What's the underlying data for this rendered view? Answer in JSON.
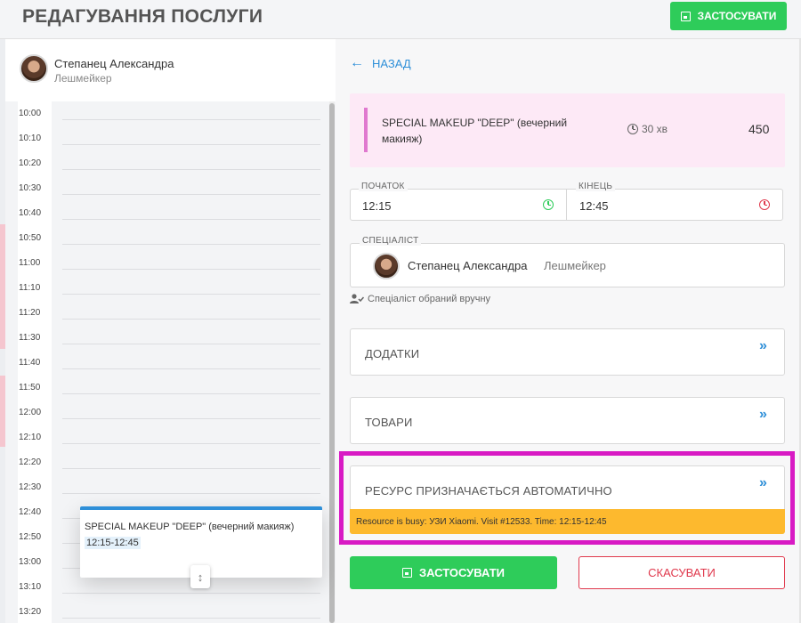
{
  "header": {
    "title": "РЕДАГУВАННЯ ПОСЛУГИ",
    "apply_label": "ЗАСТОСУВАТИ"
  },
  "specialist": {
    "name": "Степанец Александра",
    "role": "Лешмейкер"
  },
  "calendar": {
    "times": [
      "10:00",
      "10:10",
      "10:20",
      "10:30",
      "10:40",
      "10:50",
      "11:00",
      "11:10",
      "11:20",
      "11:30",
      "11:40",
      "11:50",
      "12:00",
      "12:10",
      "12:20",
      "12:30",
      "12:40",
      "12:50",
      "13:00",
      "13:10",
      "13:20"
    ],
    "event": {
      "title": "SPECIAL MAKEUP \"DEEP\" (вечерний макияж)",
      "time": "12:15-12:45",
      "color": "#2e8fd8"
    }
  },
  "form": {
    "back_label": "НАЗАД",
    "service": {
      "name": "SPECIAL MAKEUP \"DEEP\" (вечерний макияж)",
      "duration": "30 хв",
      "price": "450"
    },
    "start": {
      "label": "ПОЧАТОК",
      "value": "12:15"
    },
    "end": {
      "label": "КІНЕЦЬ",
      "value": "12:45"
    },
    "specialist": {
      "label": "СПЕЦІАЛІСТ",
      "name": "Степанец Александра",
      "role": "Лешмейкер",
      "note": "Спеціаліст обраний вручну"
    },
    "addons_label": "ДОДАТКИ",
    "goods_label": "ТОВАРИ",
    "resource_label": "РЕСУРС ПРИЗНАЧАЄТЬСЯ АВТОМАТИЧНО",
    "resource_warning": "Resource is busy: УЗИ Xiaomi. Visit #12533. Time: 12:15-12:45",
    "apply_label": "ЗАСТОСУВАТИ",
    "cancel_label": "СКАСУВАТИ"
  },
  "colors": {
    "accent": "#2e8fd8",
    "success": "#2ecc5a",
    "danger": "#e0394d",
    "warning": "#fdb92e",
    "highlight": "#d81ac4",
    "service_bg": "#fde9f6"
  }
}
